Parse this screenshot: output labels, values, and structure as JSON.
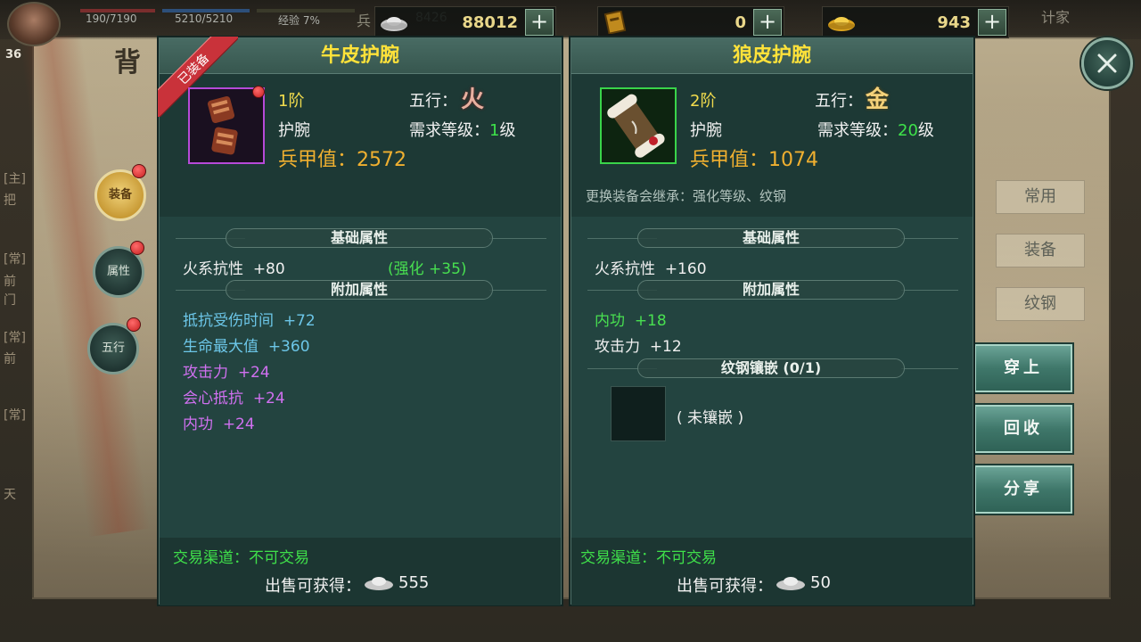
{
  "topbar": {
    "hp_text": "190/7190",
    "mp_text": "5210/5210",
    "exp_text": "经验 7%",
    "currency": [
      {
        "name": "silver-ingot-icon",
        "value": "88012"
      },
      {
        "name": "ticket-icon",
        "value": "0"
      },
      {
        "name": "gold-ingot-icon",
        "value": "943"
      }
    ],
    "partial_label": "兵",
    "partial_number": "8426",
    "top_right_text": "计家"
  },
  "background": {
    "title_glyph": "背",
    "level": "36",
    "side_texts": [
      "[主]",
      "把",
      "[常]",
      "前",
      "门",
      "[常]",
      "前",
      "[常]",
      "天"
    ]
  },
  "left_nav": {
    "equip_label": "装备",
    "attr_label": "属性",
    "wuxing_label": "五行"
  },
  "right_menu": {
    "tabs": [
      "常用",
      "装备",
      "纹钢"
    ],
    "buttons": {
      "wear": "穿上",
      "recycle": "回收",
      "share": "分享"
    }
  },
  "left_panel": {
    "title": "牛皮护腕",
    "ribbon": "已装备",
    "tier": "1阶",
    "wuxing_label": "五行：",
    "wuxing_glyph": "火",
    "type": "护腕",
    "req_level_label": "需求等级：",
    "req_level_value": "1",
    "req_level_unit": "级",
    "armor_label": "兵甲值：",
    "armor_value": "2572",
    "base_header": "基础属性",
    "base_attr": {
      "name": "火系抗性",
      "value": "+80",
      "enhance": "(强化 +35)"
    },
    "extra_header": "附加属性",
    "extra_attrs": [
      {
        "name": "抵抗受伤时间",
        "value": "+72",
        "color": "blue"
      },
      {
        "name": "生命最大值",
        "value": "+360",
        "color": "blue"
      },
      {
        "name": "攻击力",
        "value": "+24",
        "color": "purple"
      },
      {
        "name": "会心抵抗",
        "value": "+24",
        "color": "purple"
      },
      {
        "name": "内功",
        "value": "+24",
        "color": "purple"
      }
    ],
    "trade": "交易渠道：不可交易",
    "sell_label": "出售可获得：",
    "sell_value": "555"
  },
  "right_panel": {
    "title": "狼皮护腕",
    "tier": "2阶",
    "wuxing_label": "五行：",
    "wuxing_glyph": "金",
    "type": "护腕",
    "req_level_label": "需求等级：",
    "req_level_value": "20",
    "req_level_unit": "级",
    "armor_label": "兵甲值：",
    "armor_value": "1074",
    "inherit_note": "更换装备会继承：强化等级、纹钢",
    "base_header": "基础属性",
    "base_attr": {
      "name": "火系抗性",
      "value": "+160"
    },
    "extra_header": "附加属性",
    "extra_attrs": [
      {
        "name": "内功",
        "value": "+18",
        "color": "green"
      },
      {
        "name": "攻击力",
        "value": "+12",
        "color": "white"
      }
    ],
    "gem_header": "纹钢镶嵌 (0/1)",
    "gem_empty": "( 未镶嵌 )",
    "trade": "交易渠道：不可交易",
    "sell_label": "出售可获得：",
    "sell_value": "50"
  },
  "colors": {
    "title_yellow": "#ffe23a",
    "armor_orange": "#f0b030",
    "trade_green": "#3fe04a",
    "panel_bg": "#1e3a36",
    "purple_frame": "#b64ad8",
    "green_frame": "#39d44a"
  }
}
